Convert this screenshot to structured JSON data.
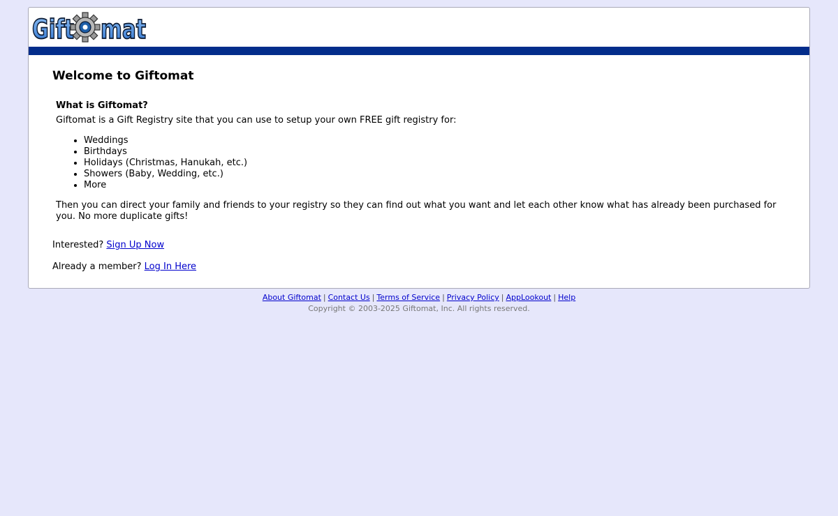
{
  "site": {
    "logo_text": "Giftomat"
  },
  "main": {
    "welcome_title": "Welcome to Giftomat",
    "what_title": "What is Giftomat?",
    "intro": "Giftomat is a Gift Registry site that you can use to setup your own FREE gift registry for:",
    "uses": [
      "Weddings",
      "Birthdays",
      "Holidays (Christmas, Hanukah, etc.)",
      "Showers (Baby, Wedding, etc.)",
      "More"
    ],
    "direct": "Then you can direct your family and friends to your registry so they can find out what you want and let each other know what has already been purchased for you. No more duplicate gifts!",
    "interested_label": "Interested?",
    "signup_link": "Sign Up Now",
    "member_label": "Already a member?",
    "login_link": "Log In Here"
  },
  "footer": {
    "links": [
      "About Giftomat",
      "Contact Us",
      "Terms of Service",
      "Privacy Policy",
      "AppLookout",
      "Help"
    ],
    "separator": "|",
    "copyright": "Copyright © 2003-2025 Giftomat, Inc. All rights reserved."
  },
  "colors": {
    "page_bg": "#e6e7fb",
    "header_bar": "#032d8b",
    "logo_blue": "#3f8be0",
    "link": "#0000cc"
  }
}
